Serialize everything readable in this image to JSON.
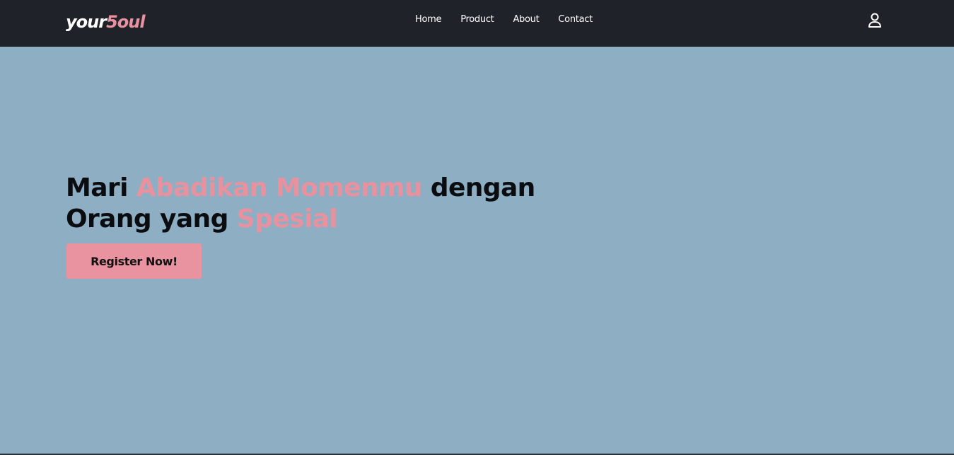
{
  "navbar": {
    "brand_prefix": "your",
    "brand_suffix": "5oul",
    "links": [
      "Home",
      "Product",
      "About",
      "Contact"
    ],
    "user_icon": "user-icon"
  },
  "hero": {
    "line1_a": "Mari ",
    "line1_b": "Abadikan Momenmu",
    "line1_c": " dengan",
    "line2_a": "Orang yang ",
    "line2_b": "Spesial",
    "cta_label": "Register Now!"
  },
  "colors": {
    "navbar_bg": "#1f2329",
    "page_bg": "#8eaec4",
    "accent": "#e8919f",
    "text_dark": "#0b0c10"
  }
}
